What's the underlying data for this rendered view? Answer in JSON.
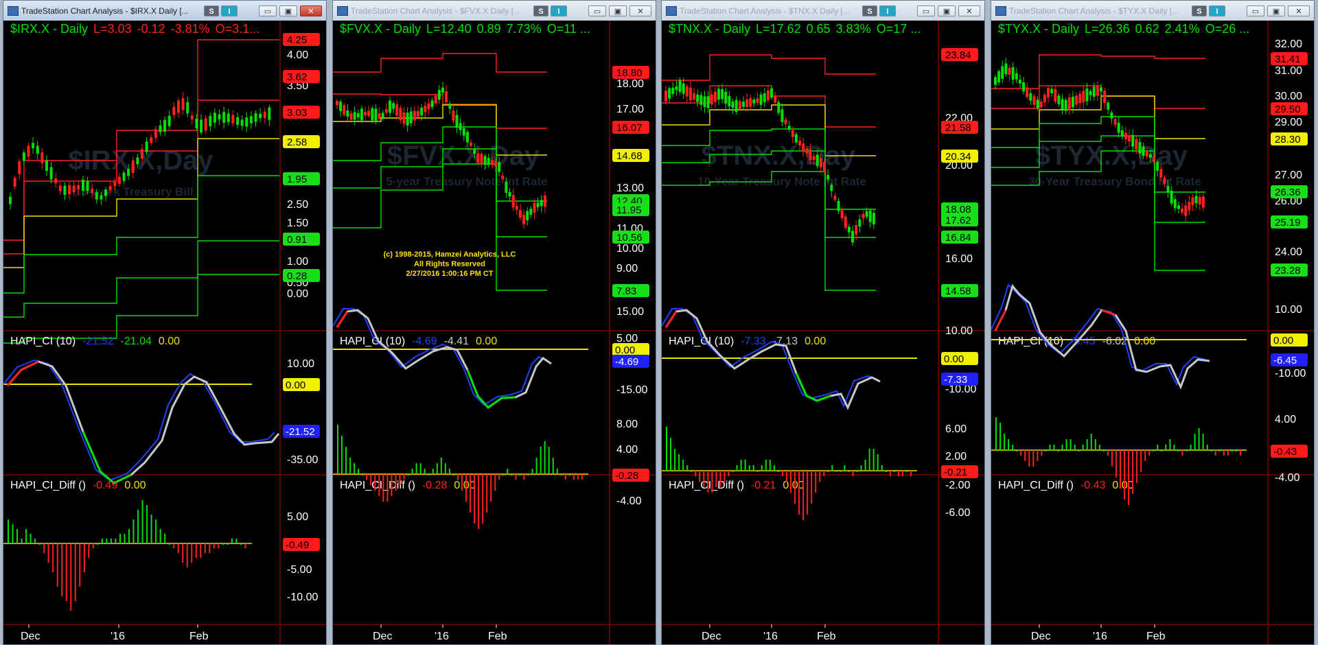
{
  "colors": {
    "red": "#ff2020",
    "green": "#00e000",
    "yellow": "#f0e000",
    "blue": "#2040ff",
    "white": "#ffffff",
    "grey": "#c8c8c8",
    "labelRed": "#ff1a1a",
    "labelGreen": "#18e018",
    "labelYellow": "#f0f000",
    "labelBlue": "#2020ff"
  },
  "windows": [
    {
      "title": "TradeStation Chart Analysis - $IRX.X Daily [...",
      "active": true,
      "buttons": {
        "s": "S",
        "i": "I"
      },
      "price_title_symbol": "$IRX.X - Daily",
      "price_title_L": "L=3.03",
      "price_title_chg": "-0.12",
      "price_title_pct": "-3.81%",
      "price_title_O": "O=3.1...",
      "watermark": "$IRX.X,Day",
      "watermark_sub": "13-week Treasury Bill",
      "copyright": [],
      "price_ticks": [
        "4.00",
        "3.50",
        "2.50",
        "1.50",
        "1.00",
        "0.50",
        "0.00"
      ],
      "price_labels": [
        {
          "text": "4.25",
          "color": "red"
        },
        {
          "text": "3.62",
          "color": "red"
        },
        {
          "text": "3.03",
          "color": "red"
        },
        {
          "text": "2.58",
          "color": "yellow"
        },
        {
          "text": "1.95",
          "color": "green"
        },
        {
          "text": "0.91",
          "color": "green"
        },
        {
          "text": "0.28",
          "color": "green"
        }
      ],
      "ci_title": "HAPI_CI (10)",
      "ci_v1": "-21.52",
      "ci_v2": "-21.04",
      "ci_v3": "0.00",
      "ci_ticks": [
        "10.00",
        "-35.00"
      ],
      "ci_labels": [
        {
          "text": "0.00",
          "color": "yellow"
        },
        {
          "text": "-21.52",
          "color": "blue"
        }
      ],
      "diff_title": "HAPI_CI_Diff ()",
      "diff_v1": "-0.49",
      "diff_v2": "0.00",
      "diff_ticks": [
        "5.00",
        "-5.00",
        "-10.00"
      ],
      "diff_labels": [
        {
          "text": "-0.49",
          "color": "red"
        }
      ],
      "date_labels": [
        "Dec",
        "'16",
        "Feb"
      ]
    },
    {
      "title": "TradeStation Chart Analysis - $FVX.X Daily [...",
      "active": false,
      "buttons": {
        "s": "S",
        "i": "I"
      },
      "price_title_symbol": "$FVX.X - Daily",
      "price_title_L": "L=12.40",
      "price_title_chg": "0.89",
      "price_title_pct": "7.73%",
      "price_title_O": "O=11 ...",
      "watermark": "$FVX.X,Day",
      "watermark_sub": "5-year Treasury Note Int Rate",
      "copyright": [
        "(c) 1998-2015, Hamzei Analytics, LLC",
        "All Rights Reserved",
        "2/27/2016 1:00:16 PM CT"
      ],
      "price_ticks": [
        "18.00",
        "17.00",
        "13.00",
        "11.00",
        "10.00",
        "9.00",
        "8.00"
      ],
      "price_labels": [
        {
          "text": "18.80",
          "color": "red"
        },
        {
          "text": "16.07",
          "color": "red"
        },
        {
          "text": "14.68",
          "color": "yellow"
        },
        {
          "text": "12.40",
          "color": "green"
        },
        {
          "text": "11.95",
          "color": "green"
        },
        {
          "text": "10.56",
          "color": "green"
        },
        {
          "text": "7.83",
          "color": "green"
        }
      ],
      "ci_title": "HAPI_CI (10)",
      "ci_v1": "-4.69",
      "ci_v2": "-4.41",
      "ci_v3": "0.00",
      "ci_ticks": [
        "15.00",
        "5.00",
        "-15.00"
      ],
      "ci_labels": [
        {
          "text": "0.00",
          "color": "yellow"
        },
        {
          "text": "-4.69",
          "color": "blue"
        }
      ],
      "diff_title": "HAPI_CI_Diff ()",
      "diff_v1": "-0.28",
      "diff_v2": "0.00",
      "diff_ticks": [
        "8.00",
        "4.00",
        "-4.00"
      ],
      "diff_labels": [
        {
          "text": "-0.28",
          "color": "red"
        }
      ],
      "date_labels": [
        "Dec",
        "'16",
        "Feb"
      ]
    },
    {
      "title": "TradeStation Chart Analysis - $TNX.X Daily [...",
      "active": false,
      "buttons": {
        "s": "S",
        "i": "I"
      },
      "price_title_symbol": "$TNX.X - Daily",
      "price_title_L": "L=17.62",
      "price_title_chg": "0.65",
      "price_title_pct": "3.83%",
      "price_title_O": "O=17 ...",
      "watermark": "$TNX.X,Day",
      "watermark_sub": "10-Year Treasury Note Int Rate",
      "copyright": [],
      "price_ticks": [
        "22.00",
        "20.00",
        "16.00"
      ],
      "price_labels": [
        {
          "text": "23.84",
          "color": "red"
        },
        {
          "text": "21.58",
          "color": "red"
        },
        {
          "text": "20.34",
          "color": "yellow"
        },
        {
          "text": "18.08",
          "color": "green"
        },
        {
          "text": "17.62",
          "color": "green"
        },
        {
          "text": "16.84",
          "color": "green"
        },
        {
          "text": "14.58",
          "color": "green"
        }
      ],
      "ci_title": "HAPI_CI (10)",
      "ci_v1": "-7.33",
      "ci_v2": "-7.13",
      "ci_v3": "0.00",
      "ci_ticks": [
        "10.00",
        "-10.00"
      ],
      "ci_labels": [
        {
          "text": "0.00",
          "color": "yellow"
        },
        {
          "text": "-7.33",
          "color": "blue"
        }
      ],
      "diff_title": "HAPI_CI_Diff ()",
      "diff_v1": "-0.21",
      "diff_v2": "0.00",
      "diff_ticks": [
        "6.00",
        "2.00",
        "-2.00",
        "-6.00"
      ],
      "diff_labels": [
        {
          "text": "-0.21",
          "color": "red"
        }
      ],
      "date_labels": [
        "Dec",
        "'16",
        "Feb"
      ]
    },
    {
      "title": "TradeStation Chart Analysis - $TYX.X Daily [...",
      "active": false,
      "buttons": {
        "s": "S",
        "i": "I"
      },
      "price_title_symbol": "$TYX.X - Daily",
      "price_title_L": "L=26.36",
      "price_title_chg": "0.62",
      "price_title_pct": "2.41%",
      "price_title_O": "O=26 ...",
      "watermark": "$TYX.X,Day",
      "watermark_sub": "30-Year Treasury Bond Int Rate",
      "copyright": [],
      "price_ticks": [
        "32.00",
        "31.00",
        "30.00",
        "29.00",
        "27.00",
        "26.00",
        "25.00",
        "24.00"
      ],
      "price_labels": [
        {
          "text": "31.41",
          "color": "red"
        },
        {
          "text": "29.50",
          "color": "red"
        },
        {
          "text": "28.30",
          "color": "yellow"
        },
        {
          "text": "26.36",
          "color": "green"
        },
        {
          "text": "25.19",
          "color": "green"
        },
        {
          "text": "23.28",
          "color": "green"
        }
      ],
      "ci_title": "HAPI_CI (10)",
      "ci_v1": "-6.45",
      "ci_v2": "-6.02",
      "ci_v3": "0.00",
      "ci_ticks": [
        "10.00",
        "-10.00"
      ],
      "ci_labels": [
        {
          "text": "0.00",
          "color": "yellow"
        },
        {
          "text": "-6.45",
          "color": "blue"
        }
      ],
      "diff_title": "HAPI_CI_Diff ()",
      "diff_v1": "-0.43",
      "diff_v2": "0.00",
      "diff_ticks": [
        "4.00",
        "-4.00"
      ],
      "diff_labels": [
        {
          "text": "-0.43",
          "color": "red"
        }
      ],
      "date_labels": [
        "Dec",
        "'16",
        "Feb"
      ]
    }
  ]
}
